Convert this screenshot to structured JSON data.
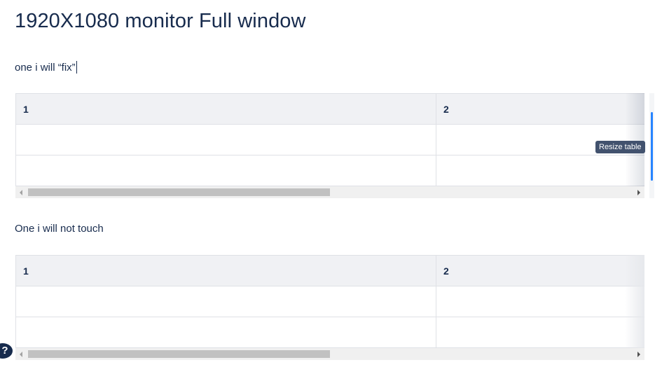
{
  "page": {
    "title": "1920X1080 monitor Full window",
    "paragraph1": "one i will “fix”",
    "paragraph2": "One i will not touch"
  },
  "table1": {
    "headers": [
      "1",
      "2"
    ],
    "rows": [
      [
        "",
        ""
      ],
      [
        "",
        ""
      ]
    ],
    "tooltip": "Resize table"
  },
  "table2": {
    "headers": [
      "1",
      "2"
    ],
    "rows": [
      [
        "",
        ""
      ],
      [
        "",
        ""
      ]
    ]
  },
  "help": {
    "label": "?"
  },
  "colors": {
    "text": "#172b4d",
    "header_bg": "#f0f1f4",
    "border": "#dfe1e6",
    "accent": "#2684ff",
    "tooltip_bg": "#42526e"
  },
  "icons": {
    "help": "question-mark-icon",
    "scroll_left": "chevron-left-icon",
    "scroll_right": "chevron-right-icon"
  }
}
